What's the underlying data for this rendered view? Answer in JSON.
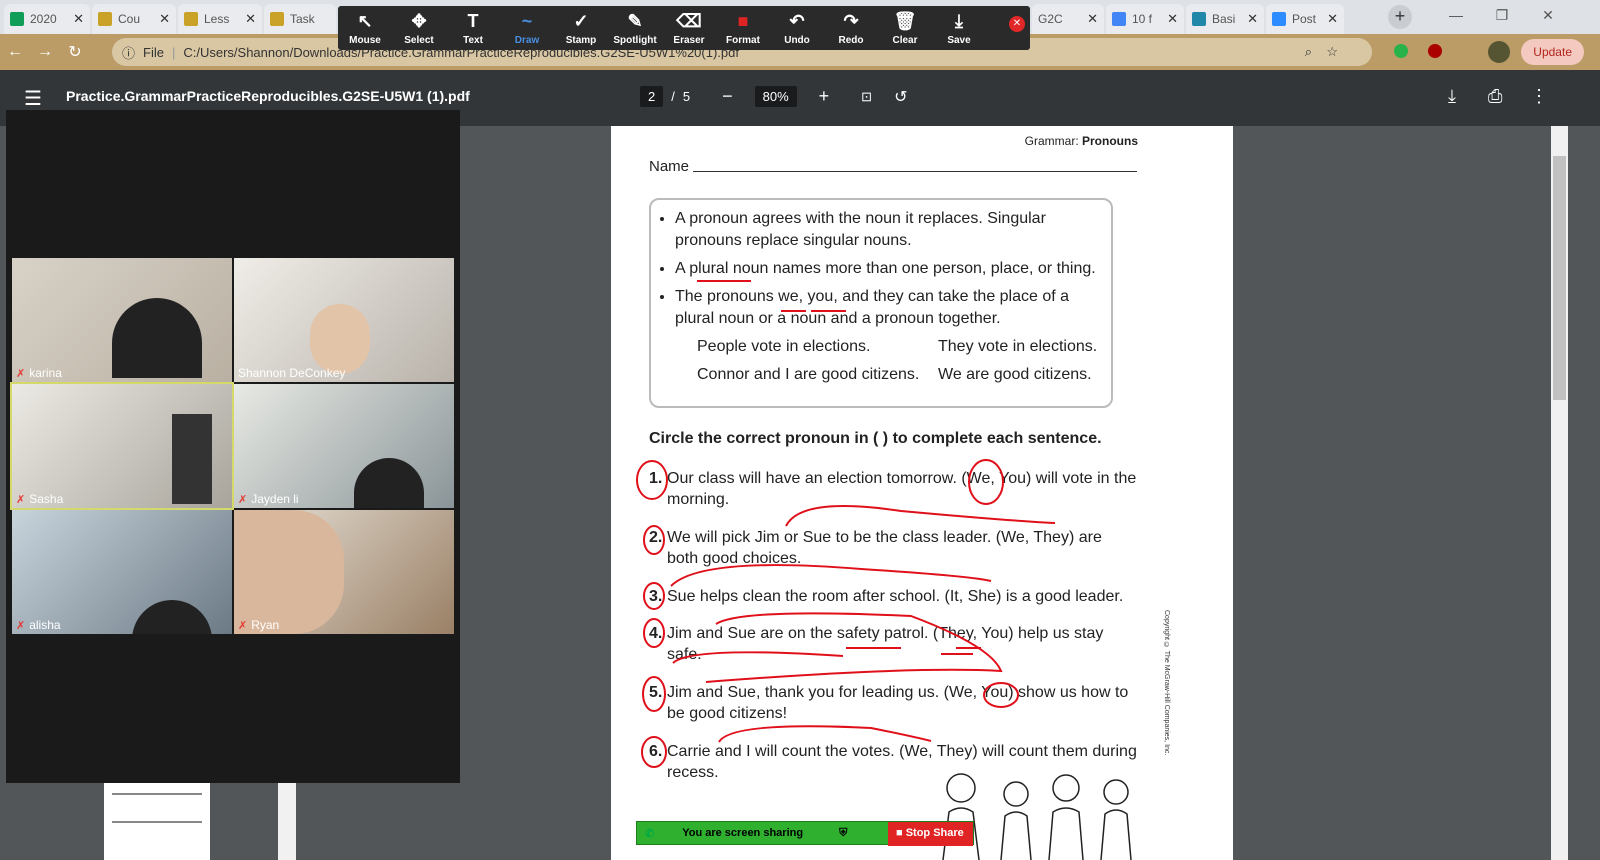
{
  "browser": {
    "tabs": [
      {
        "title": "2020",
        "color": "#0f9d58"
      },
      {
        "title": "Cou",
        "color": "#c9a227"
      },
      {
        "title": "Less",
        "color": "#c9a227"
      },
      {
        "title": "Task",
        "color": "#c9a227"
      },
      {
        "title": "G2C",
        "color": "#777"
      },
      {
        "title": "10 f",
        "color": "#4285f4"
      },
      {
        "title": "Basi",
        "color": "#28a"
      },
      {
        "title": "Post",
        "color": "#2d8cff"
      }
    ],
    "address": "C:/Users/Shannon/Downloads/Practice.GrammarPracticeReproducibles.G2SE-U5W1%20(1).pdf",
    "file_label": "File",
    "update_label": "Update",
    "new_tab": "+"
  },
  "zoom_toolbar": {
    "tools": [
      {
        "label": "Mouse",
        "glyph": "↖"
      },
      {
        "label": "Select",
        "glyph": "✥"
      },
      {
        "label": "Text",
        "glyph": "T"
      },
      {
        "label": "Draw",
        "glyph": "~"
      },
      {
        "label": "Stamp",
        "glyph": "✓"
      },
      {
        "label": "Spotlight",
        "glyph": "✎"
      },
      {
        "label": "Eraser",
        "glyph": "⌫"
      },
      {
        "label": "Format",
        "glyph": "■"
      },
      {
        "label": "Undo",
        "glyph": "↶"
      },
      {
        "label": "Redo",
        "glyph": "↷"
      },
      {
        "label": "Clear",
        "glyph": "🗑"
      },
      {
        "label": "Save",
        "glyph": "⤓"
      }
    ],
    "active": "Draw"
  },
  "pdf": {
    "filename": "Practice.GrammarPracticeReproducibles.G2SE-U5W1 (1).pdf",
    "page": "2",
    "total": "5",
    "zoom": "80%"
  },
  "participants": [
    "karina",
    "Shannon DeConkey",
    "Sasha",
    "Jayden li",
    "alisha",
    "Ryan"
  ],
  "worksheet": {
    "header_prefix": "Grammar: ",
    "header_topic": "Pronouns",
    "name_label": "Name",
    "rules": [
      "A pronoun agrees with the noun it replaces. Singular pronouns replace singular nouns.",
      "A plural noun names more than one person, place, or thing.",
      "The pronouns we, you, and they can take the place of a plural noun or a noun and a pronoun together."
    ],
    "examples": [
      "People vote in elections.",
      "They vote in elections.",
      "Connor and I are good citizens.",
      "We are good citizens."
    ],
    "instruction": "Circle the correct pronoun in ( ) to complete each sentence.",
    "sentences": [
      {
        "n": "1.",
        "t": "Our class will have an election tomorrow. (We, You) will vote in the morning."
      },
      {
        "n": "2.",
        "t": "We will pick Jim or Sue to be the class leader. (We, They) are both good choices."
      },
      {
        "n": "3.",
        "t": "Sue helps clean the room after school. (It, She) is a good leader."
      },
      {
        "n": "4.",
        "t": "Jim and Sue are on the safety patrol. (They, You) help us stay safe."
      },
      {
        "n": "5.",
        "t": "Jim and Sue, thank you for leading us. (We, You) show us how to be good citizens!"
      },
      {
        "n": "6.",
        "t": "Carrie and I will count the votes. (We, They) will count them during recess."
      }
    ],
    "copyright": "Copyright © The McGraw-Hill Companies, Inc."
  },
  "share_bar": {
    "status": "You are screen sharing",
    "stop": "Stop Share"
  },
  "colors": {
    "ink": "#e0101a",
    "toolbar": "#2a2a2a",
    "pdf_bar": "#323639"
  }
}
